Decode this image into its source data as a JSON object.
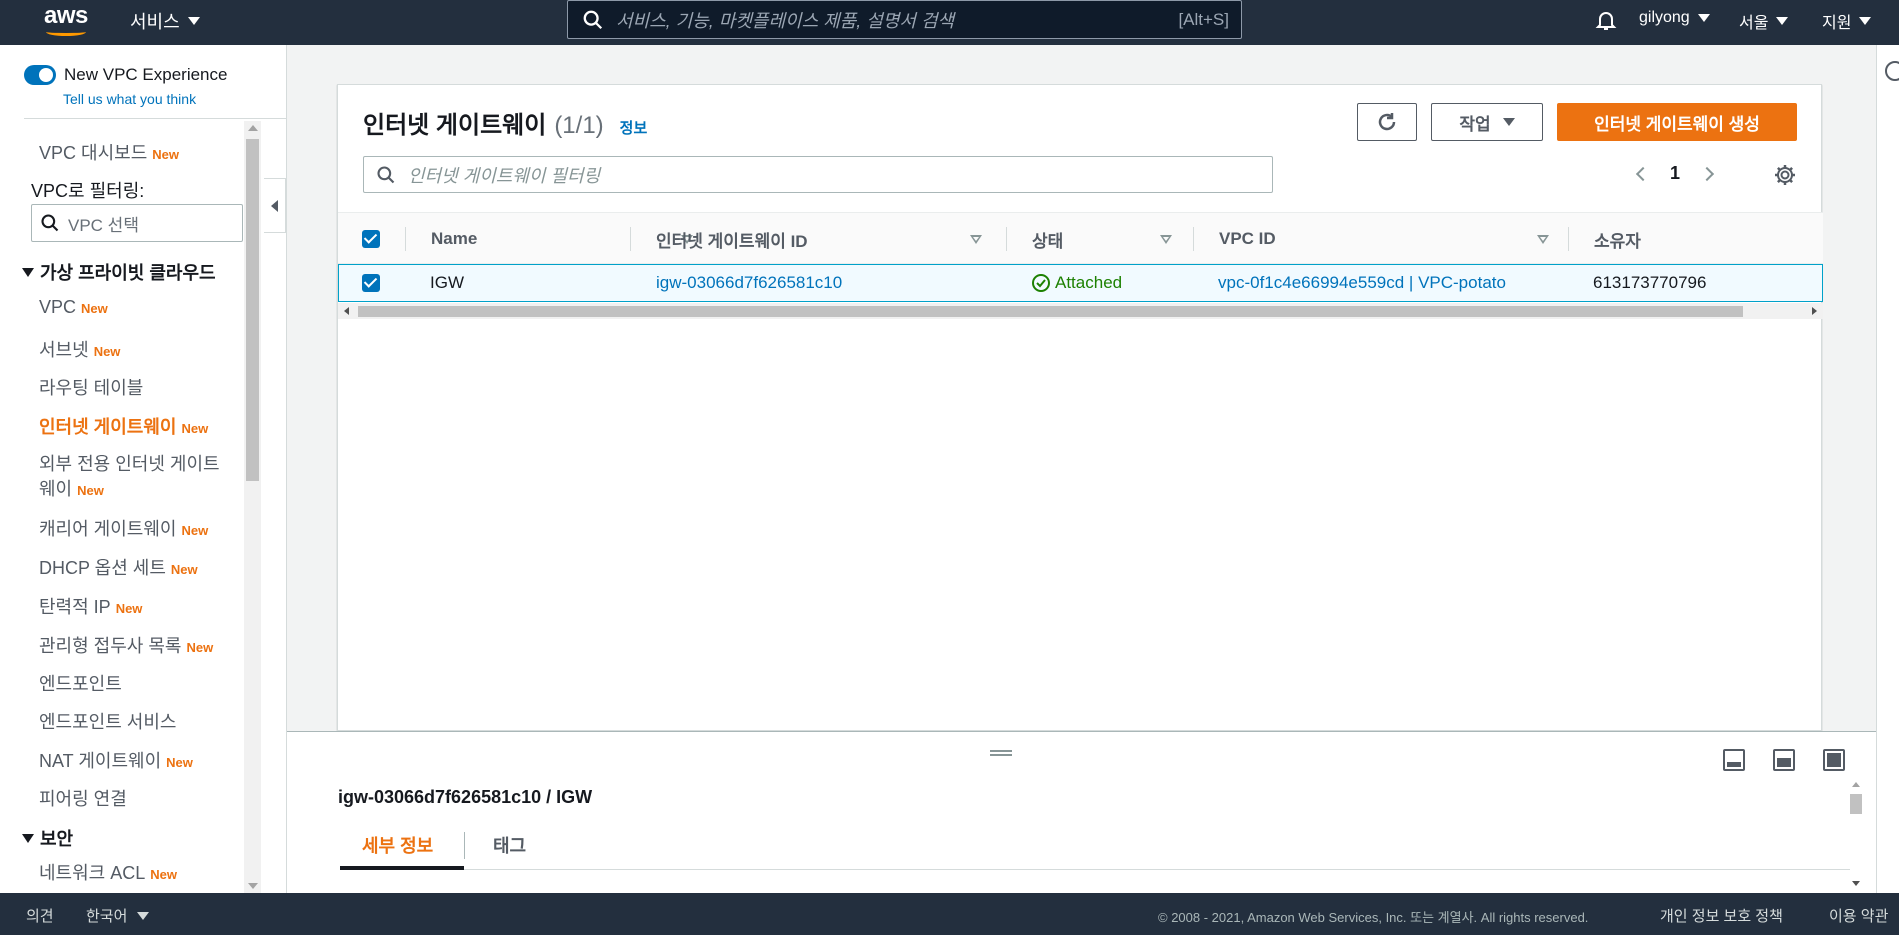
{
  "topnav": {
    "logo_text": "aws",
    "services_label": "서비스",
    "search_placeholder": "서비스, 기능, 마켓플레이스 제품, 설명서 검색",
    "search_shortcut": "[Alt+S]",
    "user": "gilyong",
    "region": "서울",
    "support": "지원"
  },
  "sidebar": {
    "toggle_label": "New VPC Experience",
    "feedback": "Tell us what you think",
    "dashboard": {
      "label": "VPC 대시보드",
      "badge": "New"
    },
    "filter_label": "VPC로 필터링:",
    "filter_placeholder": "VPC 선택",
    "section_vpc": "가상 프라이빗 클라우드",
    "items": [
      {
        "label": "VPC",
        "badge": "New"
      },
      {
        "label": "서브넷",
        "badge": "New"
      },
      {
        "label": "라우팅 테이블",
        "badge": ""
      },
      {
        "label": "인터넷 게이트웨이",
        "badge": "New"
      },
      {
        "label": "외부 전용 인터넷 게이트",
        "label2": "웨이",
        "badge": "New"
      },
      {
        "label": "캐리어 게이트웨이",
        "badge": "New"
      },
      {
        "label": "DHCP 옵션 세트",
        "badge": "New"
      },
      {
        "label": "탄력적 IP",
        "badge": "New"
      },
      {
        "label": "관리형 접두사 목록",
        "badge": "New"
      },
      {
        "label": "엔드포인트",
        "badge": ""
      },
      {
        "label": "엔드포인트 서비스",
        "badge": ""
      },
      {
        "label": "NAT 게이트웨이",
        "badge": "New"
      },
      {
        "label": "피어링 연결",
        "badge": ""
      }
    ],
    "section_security": "보안",
    "security_items": [
      {
        "label": "네트워크 ACL",
        "badge": "New"
      }
    ]
  },
  "panel": {
    "title": "인터넷 게이트웨이",
    "count": "(1/1)",
    "info": "정보",
    "actions_label": "작업",
    "create_label": "인터넷 게이트웨이 생성",
    "filter_placeholder": "인터넷 게이트웨이 필터링",
    "page": "1",
    "columns": [
      "Name",
      "인터넷 게이트웨이 ID",
      "상태",
      "VPC ID",
      "소유자"
    ],
    "rows": [
      {
        "name": "IGW",
        "id": "igw-03066d7f626581c10",
        "state": "Attached",
        "vpc": "vpc-0f1c4e66994e559cd | VPC-potato",
        "owner": "613173770796"
      }
    ]
  },
  "split": {
    "title": "igw-03066d7f626581c10 / IGW",
    "tabs": [
      "세부 정보",
      "태그"
    ]
  },
  "footer": {
    "feedback": "의견",
    "language": "한국어",
    "copyright": "© 2008 - 2021, Amazon Web Services, Inc. 또는 계열사. All rights reserved.",
    "privacy": "개인 정보 보호 정책",
    "terms": "이용 약관"
  },
  "colors": {
    "accent": "#ec7211",
    "link": "#0073bb",
    "success": "#1d8102",
    "nav_bg": "#232f3e"
  }
}
